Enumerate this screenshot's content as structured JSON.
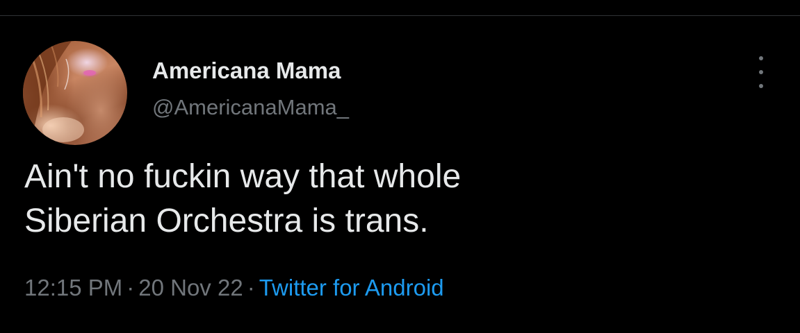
{
  "tweet": {
    "author": {
      "display_name": "Americana Mama",
      "handle": "@AmericanaMama_"
    },
    "text_lines": [
      "Ain't no fuckin way that whole",
      "Siberian Orchestra is trans."
    ],
    "meta": {
      "time": "12:15 PM",
      "separator": "·",
      "date": "20 Nov 22",
      "source": "Twitter for Android"
    },
    "more_icon": "more-vertical-icon"
  },
  "colors": {
    "background": "#000000",
    "primary_text": "#e7e9ea",
    "secondary_text": "#71767b",
    "link": "#1d9bf0",
    "divider": "#2f3336"
  }
}
